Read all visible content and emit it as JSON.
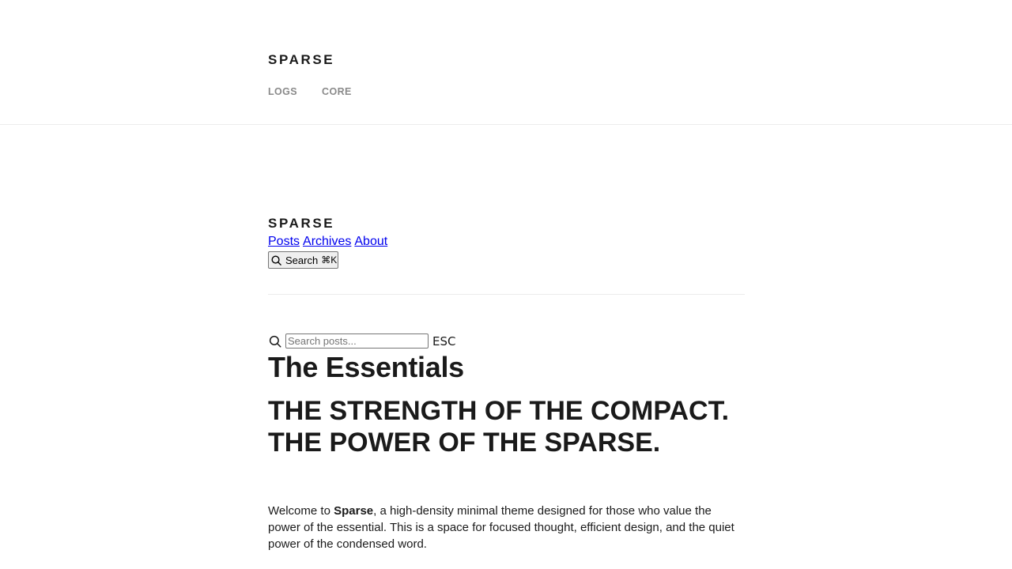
{
  "site": {
    "brand": "SPARSE"
  },
  "top_nav": {
    "items": [
      "LOGS",
      "CORE"
    ]
  },
  "secondary_header": {
    "brand": "SPARSE",
    "links": [
      "Posts",
      "Archives",
      "About"
    ],
    "search_button": {
      "label": "Search",
      "shortcut": "⌘K",
      "icon": "search-icon"
    }
  },
  "search_bar": {
    "placeholder": "Search posts...",
    "value": "",
    "escape_hint": "ESC",
    "icon": "search-icon"
  },
  "main": {
    "page_title": "The Essentials",
    "headline": "THE STRENGTH OF THE COMPACT. THE POWER OF THE SPARSE.",
    "intro": {
      "prefix": "Welcome to ",
      "brand": "Sparse",
      "suffix": ", a high-density minimal theme designed for those who value the power of the essential. This is a space for focused thought, efficient design, and the quiet power of the condensed word."
    }
  },
  "colors": {
    "text": "#1a1a1a",
    "muted_nav": "#8a8a8a",
    "link": "#0000ee",
    "divider": "#ececec"
  }
}
